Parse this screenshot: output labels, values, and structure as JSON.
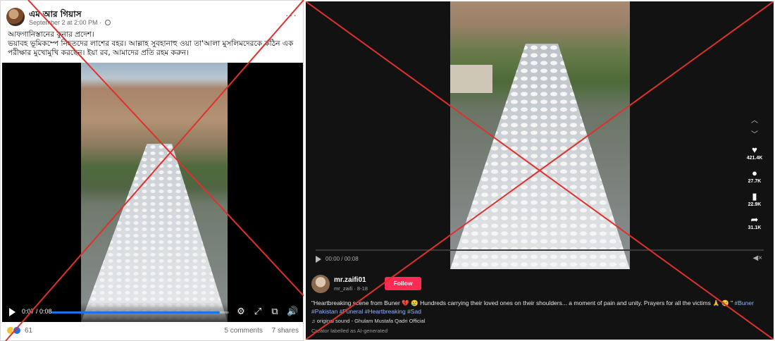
{
  "facebook": {
    "author_name": "এম আর গিয়াস",
    "post_time": "September 2 at 2:00 PM ·",
    "more_label": "···",
    "caption_line1": "আফগানিস্তানের কুনার প্রদেশ।",
    "caption_line2": "ভয়াবহ ভূমিকম্পে নিহতদের লাশের বহর। আল্লাহ সুবহানাহু ওয়া তা'আলা মুসলিমদেরকে কঠিন এক পরীক্ষার মুখোমুখি করছেন। ইয়া রব, আমাদের প্রতি রহম করুন।",
    "video": {
      "time": "0:07 / 0:08",
      "progress": 0.95
    },
    "reaction_count": "61",
    "comments": "5 comments",
    "shares": "7 shares",
    "icons": [
      "globe-icon",
      "play-icon",
      "settings-icon",
      "expand-icon",
      "pip-icon",
      "volume-icon"
    ]
  },
  "tiktok": {
    "time": "00:00 / 00:08",
    "progress": 0.0,
    "rail": {
      "likes": "421.4K",
      "comments": "27.7K",
      "saves": "22.9K",
      "shares": "31.1K"
    },
    "username": "mr.zaifi01",
    "handle_date": "mr_zaifi · 8-18",
    "follow_label": "Follow",
    "description": "\"Heartbreaking scene from Buner 💔 😢 Hundreds carrying their loved ones on their shoulders... a moment of pain and unity. Prayers for all the victims 🙏 😢 \"",
    "hashtags_line1": "#Buner",
    "hashtags_line2": "#Pakistan #Funeral #Heartbreaking #Sad",
    "sound": "♫ original sound - Ghulam Mustafa Qadri Official",
    "ai_label": "Creator labelled as AI-generated",
    "icons": [
      "heart-icon",
      "comment-icon",
      "bookmark-icon",
      "share-icon",
      "volume-mute-icon",
      "chevron-up-icon",
      "chevron-down-icon"
    ]
  },
  "overlay_color": "#e0302b"
}
